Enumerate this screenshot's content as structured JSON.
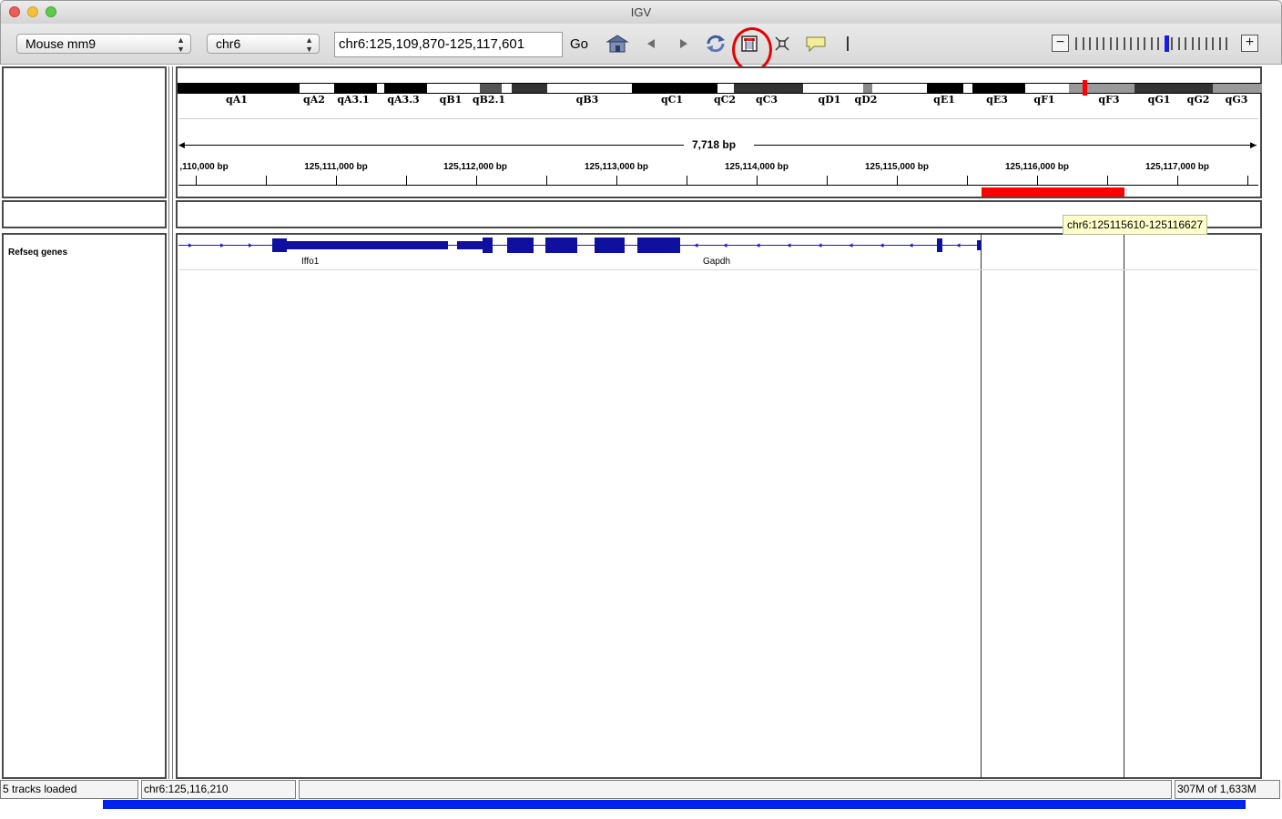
{
  "window": {
    "title": "IGV"
  },
  "toolbar": {
    "genome": "Mouse mm9",
    "chromosome": "chr6",
    "locus": "chr6:125,109,870-125,117,601",
    "go_label": "Go",
    "icons": [
      "home-icon",
      "back-icon",
      "forward-icon",
      "refresh-icon",
      "region-of-interest-icon",
      "resize-to-window-icon",
      "popup-text-icon",
      "ruler-icon"
    ]
  },
  "ideogram": {
    "bands": [
      "qA1",
      "qA2",
      "qA3.1",
      "qA3.3",
      "qB1",
      "qB2.1",
      "qB3",
      "qC1",
      "qC2",
      "qC3",
      "qD1",
      "qD2",
      "qE1",
      "qE3",
      "qF1",
      "qF3",
      "qG1",
      "qG2",
      "qG3"
    ]
  },
  "ruler": {
    "span": "7,718 bp",
    "labels": [
      ",110,000 bp",
      "125,111,000 bp",
      "125,112,000 bp",
      "125,113,000 bp",
      "125,114,000 bp",
      "125,115,000 bp",
      "125,116,000 bp",
      "125,117,000 bp"
    ]
  },
  "region": {
    "tooltip": "chr6:125115610-125116627",
    "color": "#ff0000"
  },
  "tracks": {
    "refseq_name": "Refseq genes",
    "genes": [
      "Iffo1",
      "Gapdh"
    ],
    "gene_color": "#0f0fa0"
  },
  "status": {
    "tracks_loaded": "5 tracks loaded",
    "position": "chr6:125,116,210",
    "memory": "307M of 1,633M"
  },
  "zoom": {
    "level_fraction": 0.6
  }
}
